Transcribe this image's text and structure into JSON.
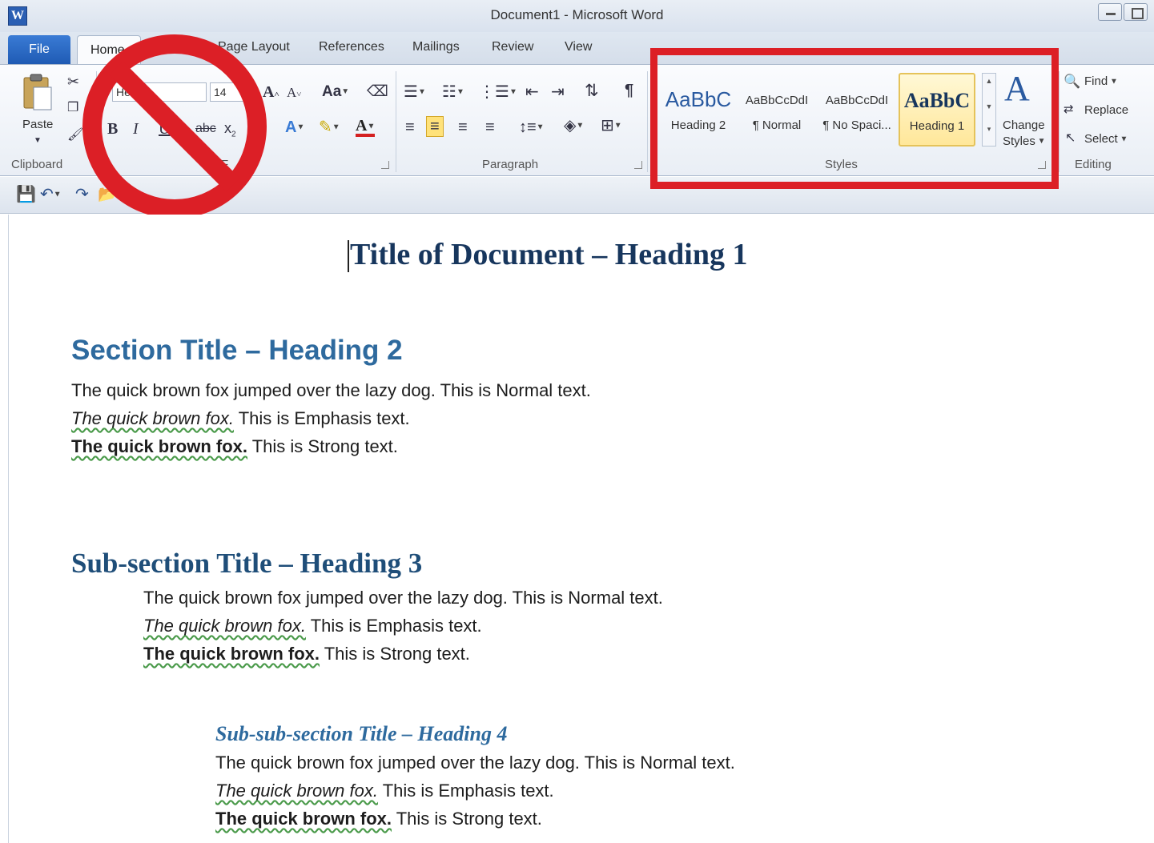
{
  "window": {
    "title": "Document1 - Microsoft Word",
    "app_icon_letter": "W"
  },
  "tabs": {
    "file": "File",
    "home": "Home",
    "page_layout": "Page Layout",
    "references": "References",
    "mailings": "Mailings",
    "review": "Review",
    "view": "View"
  },
  "ribbon": {
    "clipboard": {
      "paste_label": "Paste",
      "group_label": "Clipboard"
    },
    "font": {
      "font_name": "Headi",
      "font_size": "14",
      "group_label": "F"
    },
    "paragraph": {
      "group_label": "Paragraph"
    },
    "styles": {
      "group_label": "Styles",
      "tiles": [
        {
          "sample": "AaBbC",
          "name": "Heading 2"
        },
        {
          "sample": "AaBbCcDdI",
          "name": "¶ Normal"
        },
        {
          "sample": "AaBbCcDdI",
          "name": "¶ No Spaci..."
        },
        {
          "sample": "AaBbC",
          "name": "Heading 1"
        }
      ],
      "change_styles_line1": "Change",
      "change_styles_line2": "Styles"
    },
    "editing": {
      "group_label": "Editing",
      "find": "Find",
      "replace": "Replace",
      "select": "Select"
    }
  },
  "document": {
    "title": "Title of Document – Heading 1",
    "section": {
      "heading": "Section Title – Heading 2",
      "normal": "The quick brown fox jumped over the lazy dog. This is Normal text.",
      "emphasis_run": "The quick brown fox.",
      "emphasis_rest": " This is Emphasis text.",
      "strong_run": "The quick brown fox.",
      "strong_rest": " This is Strong text."
    },
    "subsection": {
      "heading": "Sub-section Title – Heading 3",
      "normal": "The quick brown fox jumped over the lazy dog. This is Normal text.",
      "emphasis_run": "The quick brown fox.",
      "emphasis_rest": " This is Emphasis text.",
      "strong_run": "The quick brown fox.",
      "strong_rest": " This is Strong text."
    },
    "subsubsection": {
      "heading": "Sub-sub-section Title – Heading 4",
      "normal": "The quick brown fox jumped over the lazy dog. This is Normal text.",
      "emphasis_run": "The quick brown fox.",
      "emphasis_rest": " This is Emphasis text.",
      "strong_run": "The quick brown fox.",
      "strong_rest": " This is Strong text."
    }
  },
  "colors": {
    "highlight_box": "#dc1f26",
    "prohibition_sign": "#dc1f26",
    "heading_blue": "#2e6a9e",
    "title_navy": "#17365d"
  },
  "overlays": {
    "prohibition_icon": "no-symbol",
    "highlight": "styles-gallery"
  }
}
